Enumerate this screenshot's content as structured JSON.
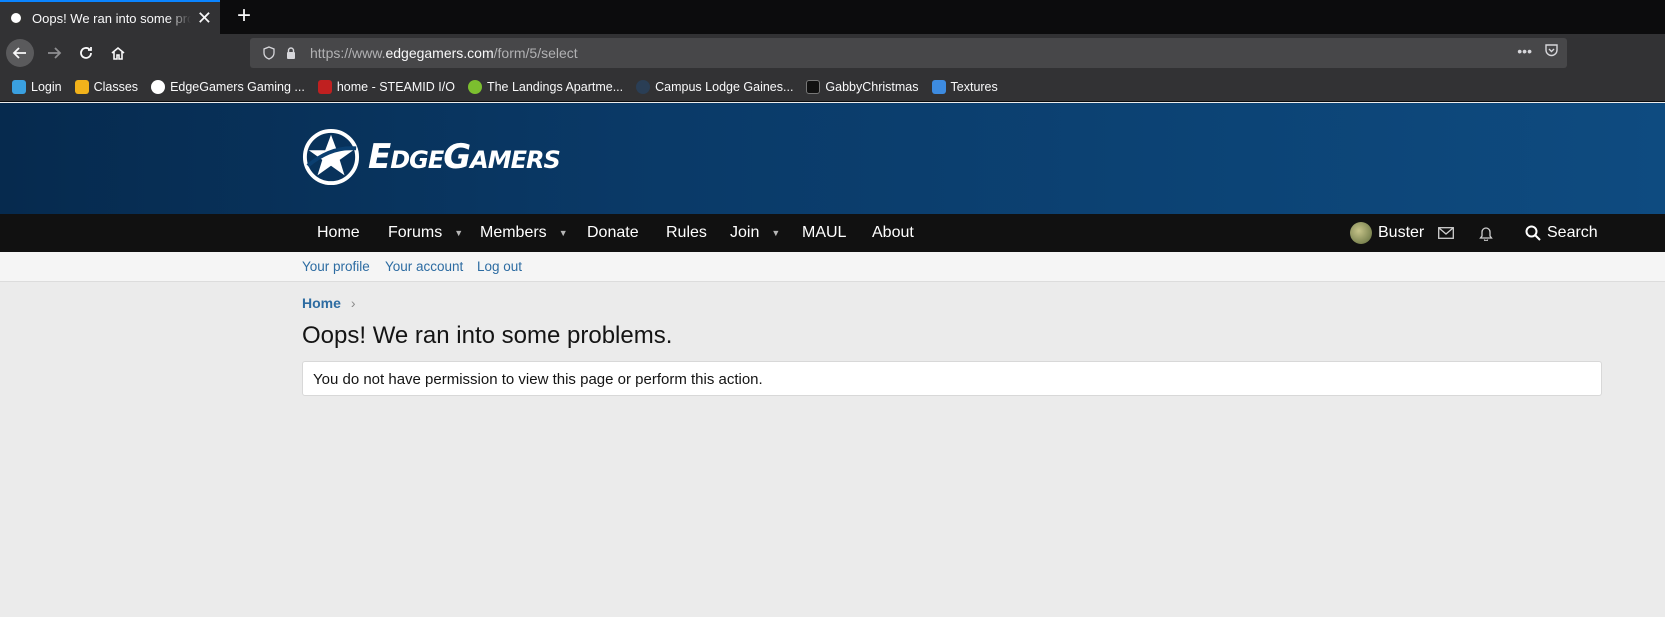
{
  "browser": {
    "tab_title": "Oops! We ran into some problems.",
    "new_tab_symbol": "+",
    "url_prefix": "https://www.",
    "url_host": "edgegamers.com",
    "url_path": "/form/5/select",
    "bookmarks": [
      {
        "label": "Login",
        "icon": "cloud-icon",
        "color": "#3aa0e0"
      },
      {
        "label": "Classes",
        "icon": "classroom-icon",
        "color": "#f2b21b"
      },
      {
        "label": "EdgeGamers Gaming ...",
        "icon": "edgegamers-icon",
        "color": "#ffffff"
      },
      {
        "label": "home - STEAMID I/O",
        "icon": "steamid-icon",
        "color": "#c02020"
      },
      {
        "label": "The Landings Apartme...",
        "icon": "landings-icon",
        "color": "#7cbf2f"
      },
      {
        "label": "Campus Lodge Gaines...",
        "icon": "campus-lodge-icon",
        "color": "#2a3e55"
      },
      {
        "label": "GabbyChristmas",
        "icon": "gabby-icon",
        "color": "#111111"
      },
      {
        "label": "Textures",
        "icon": "cube-icon",
        "color": "#3d8be0"
      }
    ]
  },
  "site": {
    "logo_text": "EdgeGamers",
    "nav": {
      "home": "Home",
      "forums": "Forums",
      "members": "Members",
      "donate": "Donate",
      "rules": "Rules",
      "join": "Join",
      "maul": "MAUL",
      "about": "About",
      "username": "Buster",
      "search": "Search"
    },
    "subnav": {
      "profile": "Your profile",
      "account": "Your account",
      "logout": "Log out"
    },
    "breadcrumb": {
      "home": "Home"
    },
    "page_title": "Oops! We ran into some problems.",
    "error_message": "You do not have permission to view this page or perform this action."
  }
}
